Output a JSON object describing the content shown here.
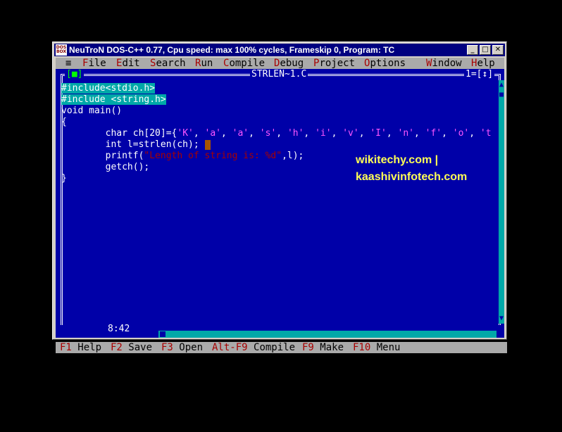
{
  "window": {
    "title": "NeuTroN DOS-C++ 0.77, Cpu speed: max 100% cycles, Frameskip  0, Program:     TC",
    "icon_text_top": "DOS",
    "icon_text_bottom": "BOX",
    "minimize_icon": "_",
    "maximize_icon": "□",
    "close_icon": "✕"
  },
  "menu": {
    "system": "≡",
    "items": [
      {
        "hot": "F",
        "rest": "ile"
      },
      {
        "hot": "E",
        "rest": "dit"
      },
      {
        "hot": "S",
        "rest": "earch"
      },
      {
        "hot": "R",
        "rest": "un"
      },
      {
        "hot": "C",
        "rest": "ompile"
      },
      {
        "hot": "D",
        "rest": "ebug"
      },
      {
        "hot": "P",
        "rest": "roject"
      },
      {
        "hot": "O",
        "rest": "ptions"
      },
      {
        "hot": "W",
        "rest": "indow"
      },
      {
        "hot": "H",
        "rest": "elp"
      }
    ]
  },
  "editor": {
    "close_box": "[■]",
    "filename": "STRLEN~1.C",
    "window_number": "1=[↕]",
    "lines": [
      "#include<stdio.h>",
      "#include <string.h>",
      "void main()",
      "{",
      "        char ch[20]={'K', 'a', 'a', 's', 'h', 'i', 'v', 'I', 'n', 'f', 'o', 't",
      "        int l=strlen(ch); ",
      "        printf(\"Length of string is: %d\",l);",
      "        getch();",
      "}"
    ],
    "cursor_position": "8:42"
  },
  "watermark": {
    "line1": "wikitechy.com |",
    "line2": "kaashivinfotech.com"
  },
  "status": {
    "items": [
      {
        "key": "F1",
        "label": "Help"
      },
      {
        "key": "F2",
        "label": "Save"
      },
      {
        "key": "F3",
        "label": "Open"
      },
      {
        "key": "Alt-F9",
        "label": "Compile"
      },
      {
        "key": "F9",
        "label": "Make"
      },
      {
        "key": "F10",
        "label": "Menu"
      }
    ]
  },
  "colors": {
    "screen_bg": "#0000a8",
    "menu_bg": "#aaaaaa",
    "hotkey": "#a80000",
    "titlebar": "#000080"
  }
}
